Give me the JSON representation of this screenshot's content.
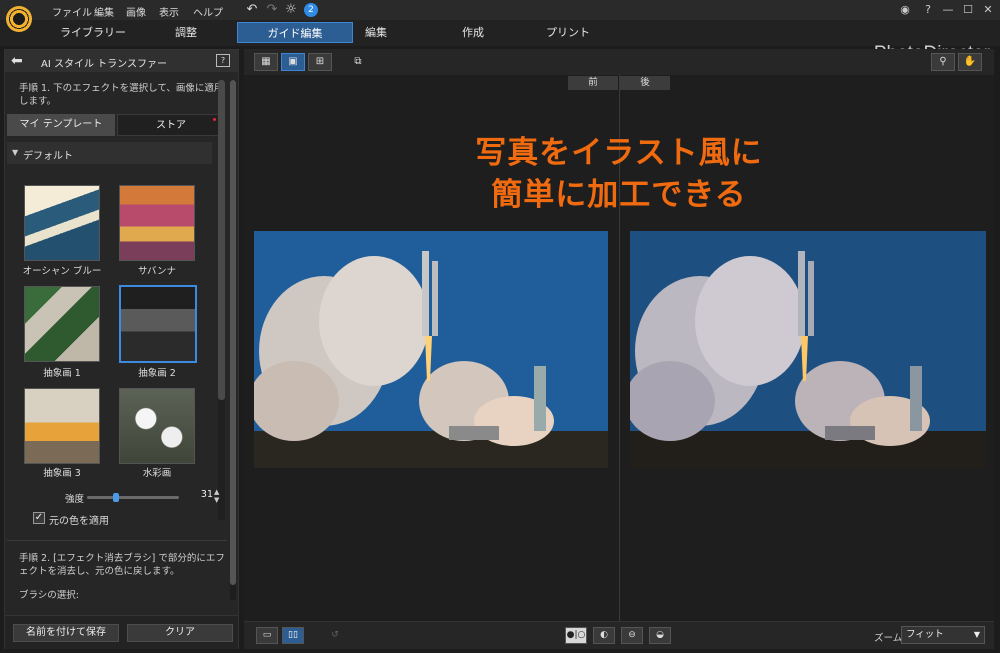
{
  "menu": [
    "ファイル",
    "編集",
    "画像",
    "表示",
    "ヘルプ"
  ],
  "notification_count": "2",
  "brand": "PhotoDirector",
  "tabs": [
    "ライブラリー",
    "調整",
    "ガイド編集",
    "編集",
    "作成",
    "プリント"
  ],
  "active_tab": "ガイド編集",
  "left_panel": {
    "title": "AI スタイル トランスファー",
    "step1": "手順 1. 下のエフェクトを選択して、画像に適用します。",
    "subtabs": [
      "マイ テンプレート",
      "ストア"
    ],
    "group": "デフォルト",
    "templates": [
      "オーシャン ブルー",
      "サバンナ",
      "抽象画 1",
      "抽象画 2",
      "抽象画 3",
      "水彩画"
    ],
    "selected_template": "抽象画 2",
    "strength_label": "強度",
    "strength_value": 31,
    "strength_max": 100,
    "orig_color_label": "元の色を適用",
    "orig_color_checked": true,
    "step2": "手順 2. [エフェクト消去ブラシ] で部分的にエフェクトを消去し、元の色に戻します。",
    "brush_label": "ブラシの選択:",
    "save_label": "名前を付けて保存",
    "clear_label": "クリア"
  },
  "canvas": {
    "before_label": "前",
    "after_label": "後",
    "caption_line1": "写真をイラスト風に",
    "caption_line2": "簡単に加工できる",
    "caption_color": "#f06a10"
  },
  "bottom": {
    "zoom_label": "ズーム:",
    "zoom_value": "フィット"
  },
  "icons": {
    "undo": "undo-icon",
    "redo": "redo-icon",
    "settings": "gear-icon",
    "account": "account-icon",
    "help": "help-icon",
    "search": "magnifier-icon",
    "pan": "hand-icon"
  }
}
